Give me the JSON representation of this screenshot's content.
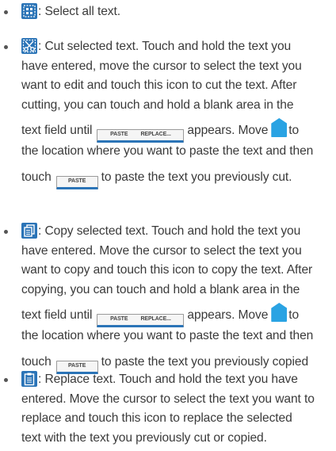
{
  "items": [
    {
      "icon": "select-all-icon",
      "lines": [
        ": Select all text."
      ]
    },
    {
      "icon": "cut-icon",
      "lines": [
        ": Cut selected text. Touch and hold the text you",
        "have entered, move the cursor to select the text you",
        "want to edit and touch this icon to cut the text. After",
        "cutting, you can touch and hold a blank area in the"
      ],
      "line5_start": "text field until",
      "line5_mid": "appears. Move",
      "line5_end": "to",
      "line6": "the location where you want to paste the text and then",
      "line7_start": "touch",
      "line7_end": "to paste the text you previously cut."
    },
    {
      "icon": "copy-icon",
      "lines": [
        ": Copy selected text. Touch and hold the text you",
        "have entered. Move the cursor to select the text you",
        "want to copy and touch this icon to copy the text. After",
        "copying, you can touch and hold a blank area in the"
      ],
      "line5_start": "text field until",
      "line5_mid": "appears. Move",
      "line5_end": "to",
      "line6": "the location where you want to paste the text and then",
      "line7_start": "touch",
      "line7_end": "to paste the text you previously copied"
    },
    {
      "icon": "replace-icon",
      "lines": [
        ": Replace text. Touch and hold the text you have",
        "entered. Move the cursor to select the text you want to",
        "replace and touch this icon to replace the selected",
        "text with the text you previously cut or copied."
      ]
    }
  ],
  "chips": {
    "paste": "PASTE",
    "replace": "REPLACE..."
  },
  "colors": {
    "icon_blue": "#2b74b7",
    "handle_blue": "#2aa3e3",
    "text": "#3a3a3a"
  }
}
